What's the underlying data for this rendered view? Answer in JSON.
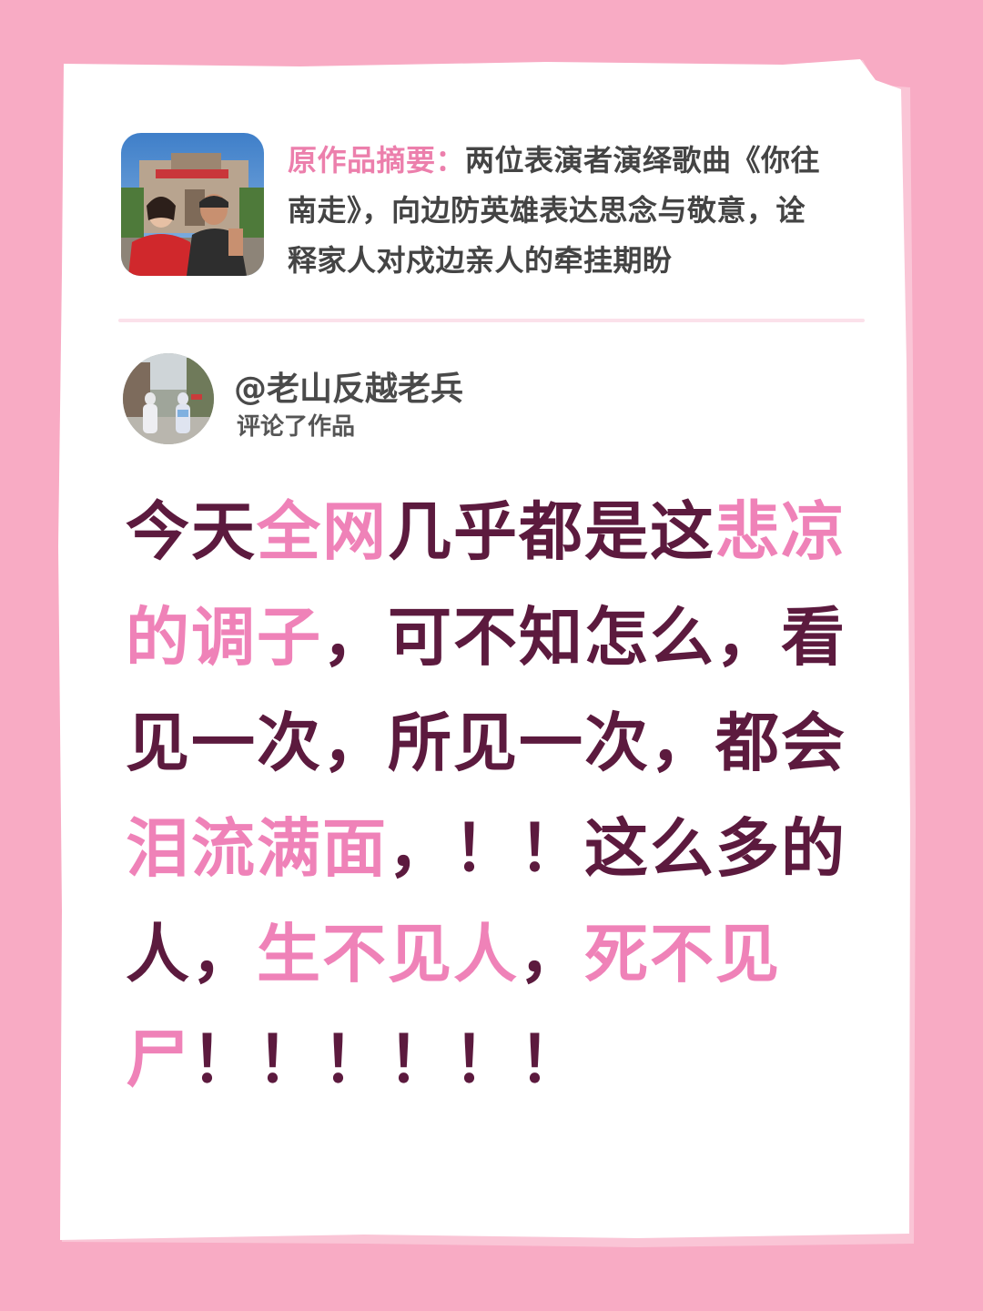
{
  "colors": {
    "background": "#f8abc4",
    "paper": "#ffffff",
    "accent_pink": "#ef82b8",
    "dark_text": "#5c1a3e"
  },
  "summary": {
    "label": "原作品摘要：",
    "text_line1": "两位表演者演绎歌曲《你往",
    "text_line2": "南走》，向边防英雄表达思念与敬意，诠",
    "text_line3": "释家人对戍边亲人的牵挂期盼"
  },
  "comment": {
    "username": "@老山反越老兵",
    "action": "评论了作品",
    "lines": [
      [
        {
          "t": "今天",
          "hl": false
        },
        {
          "t": "全网",
          "hl": true
        },
        {
          "t": "几乎都是这",
          "hl": false
        },
        {
          "t": "悲凉",
          "hl": true
        }
      ],
      [
        {
          "t": "的调子",
          "hl": true
        },
        {
          "t": "，可不知怎么，看",
          "hl": false
        }
      ],
      [
        {
          "t": "见一次，所见一次，都会",
          "hl": false
        }
      ],
      [
        {
          "t": "泪流满面",
          "hl": true
        },
        {
          "t": "，！！这么多的",
          "hl": false
        }
      ],
      [
        {
          "t": "人，",
          "hl": false
        },
        {
          "t": "生不见人",
          "hl": true
        },
        {
          "t": "，",
          "hl": false
        },
        {
          "t": "死不见",
          "hl": true
        }
      ],
      [
        {
          "t": "尸",
          "hl": true
        },
        {
          "t": "！！！！！！",
          "hl": false
        }
      ]
    ]
  }
}
